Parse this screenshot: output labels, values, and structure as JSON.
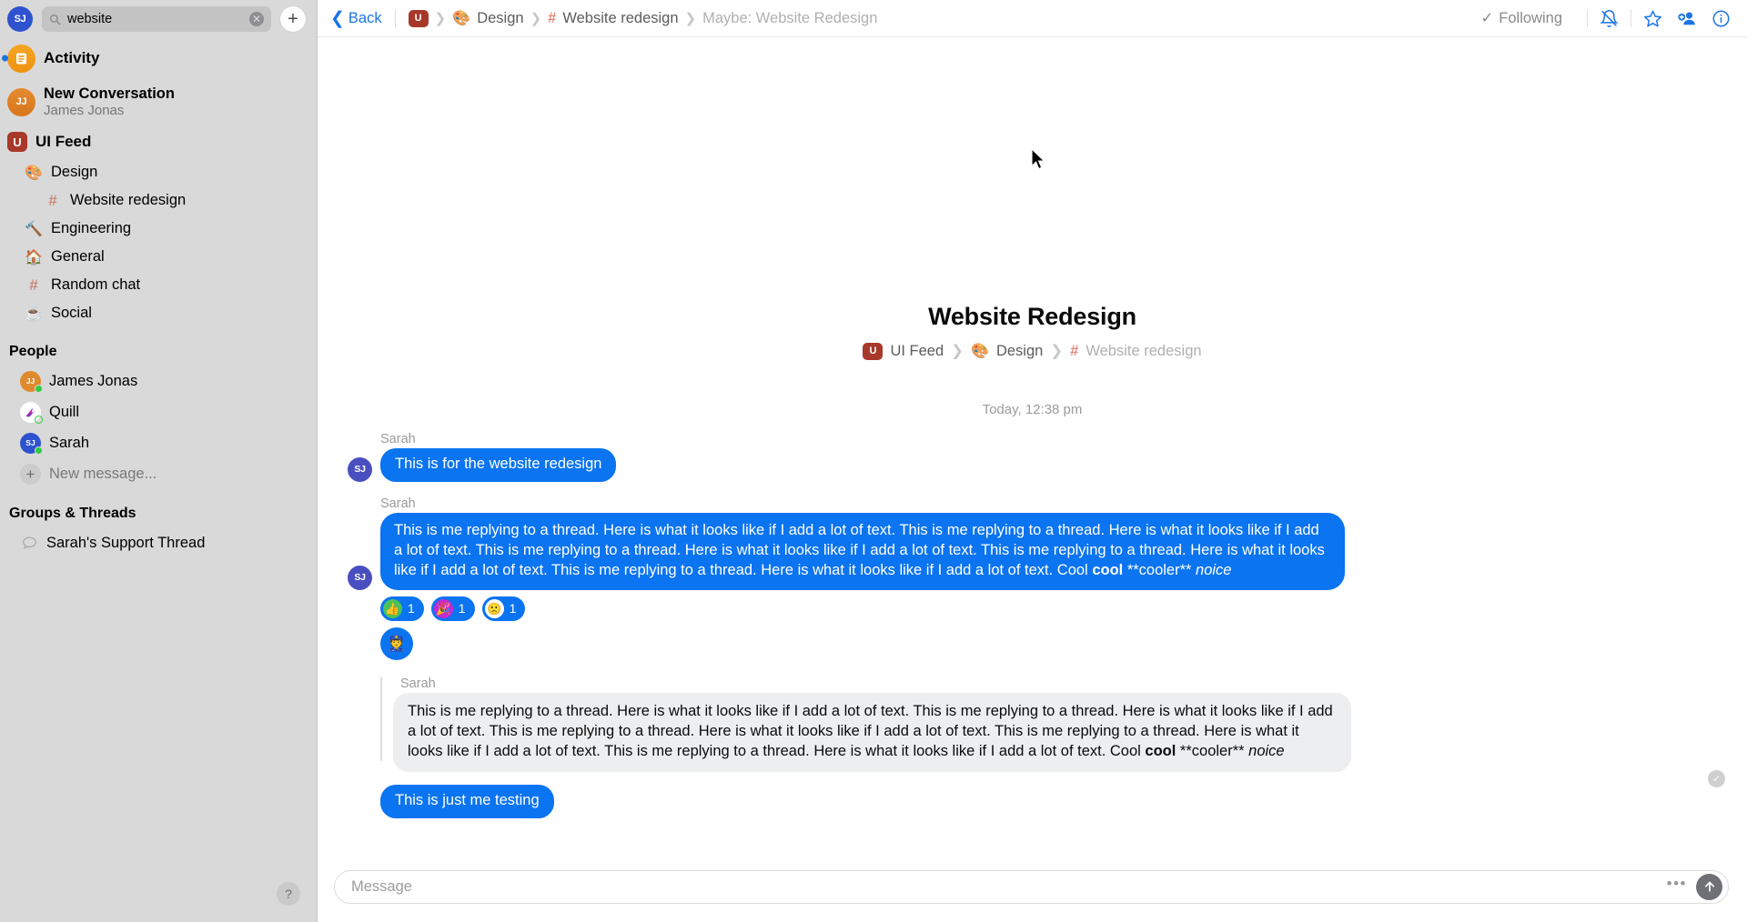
{
  "sidebar": {
    "me_initials": "SJ",
    "search": {
      "value": "website",
      "placeholder": "Search",
      "clear_label": "✕"
    },
    "new_button_label": "+",
    "activity": {
      "label": "Activity",
      "icon": "activity-icon"
    },
    "new_conversation": {
      "initials": "JJ",
      "title": "New Conversation",
      "subtitle": "James Jonas"
    },
    "ui_feed": {
      "logo_letter": "U",
      "label": "UI Feed"
    },
    "channels": [
      {
        "label": "Design",
        "icon": "🎨",
        "indent": 1
      },
      {
        "label": "Website redesign",
        "icon": "#",
        "indent": 2,
        "active": true
      },
      {
        "label": "Engineering",
        "icon": "🔨",
        "indent": 1
      },
      {
        "label": "General",
        "icon": "🏠",
        "indent": 1
      },
      {
        "label": "Random chat",
        "icon": "#",
        "indent": 1
      },
      {
        "label": "Social",
        "icon": "☕",
        "indent": 1
      }
    ],
    "people_heading": "People",
    "people": [
      {
        "name": "James Jonas",
        "initials": "JJ",
        "color": "#e08a2e",
        "status": "online"
      },
      {
        "name": "Quill",
        "initials": "",
        "color": "#ffffff",
        "status": "away"
      },
      {
        "name": "Sarah",
        "initials": "SJ",
        "color": "#2f52cf",
        "status": "online"
      }
    ],
    "new_message_label": "New message...",
    "groups_heading": "Groups & Threads",
    "groups": [
      {
        "label": "Sarah's Support Thread",
        "icon": "speech-bubble-icon"
      }
    ],
    "help_label": "?"
  },
  "topbar": {
    "back_label": "Back",
    "crumb_logo": "U",
    "crumb_design": "Design",
    "crumb_channel": "Website redesign",
    "crumb_current": "Maybe: Website Redesign",
    "following_label": "Following",
    "icons": [
      "bell-slash-icon",
      "star-icon",
      "add-person-icon",
      "info-icon"
    ]
  },
  "conversation": {
    "title": "Website Redesign",
    "breadcrumb_feed": "UI Feed",
    "breadcrumb_design": "Design",
    "breadcrumb_channel": "Website redesign",
    "daystamp": "Today, 12:38 pm"
  },
  "messages": [
    {
      "sender": "Sarah",
      "initials": "SJ",
      "text": "This is for the website redesign"
    },
    {
      "sender": "Sarah",
      "initials": "SJ",
      "text_pre": "This is me replying to a thread. Here is what it looks like if I add a lot of text. This is me replying to a thread. Here is what it looks like if I add a lot of text. This is me replying to a thread. Here is what it looks like if I add a lot of text. This is me replying to a thread. Here is what it looks like if I add a lot of text. This is me replying to a thread. Here is what it looks like if I add a lot of text. Cool ",
      "text_bold": "cool",
      "text_mid": " **cooler** ",
      "text_italic": "noice"
    }
  ],
  "reactions": [
    {
      "emoji": "👍",
      "count": "1",
      "bg": "#4cc15a"
    },
    {
      "emoji": "🎉",
      "count": "1",
      "bg": "#c42ad0"
    },
    {
      "emoji": "🙁",
      "count": "1",
      "bg": "#ffffff"
    }
  ],
  "emoji_message": "👮",
  "thread_reply": {
    "sender": "Sarah",
    "text_pre": "This is me replying to a thread. Here is what it looks like if I add a lot of text. This is me replying to a thread. Here is what it looks like if I add a lot of text. This is me replying to a thread. Here is what it looks like if I add a lot of text. This is me replying to a thread. Here is what it looks like if I add a lot of text. This is me replying to a thread. Here is what it looks like if I add a lot of text. Cool ",
    "text_bold": "cool",
    "text_mid": " **cooler** ",
    "text_italic": "noice"
  },
  "last_message": {
    "text": "This is just me testing"
  },
  "composer": {
    "placeholder": "Message",
    "dots": "•••",
    "send_icon": "arrow-up-icon"
  },
  "colors": {
    "accent_blue": "#0b74f0",
    "link_blue": "#1b74e4",
    "sidebar_bg": "#d9d9d9",
    "bubble_gray": "#edeef0",
    "brand_red": "#a8382a"
  }
}
